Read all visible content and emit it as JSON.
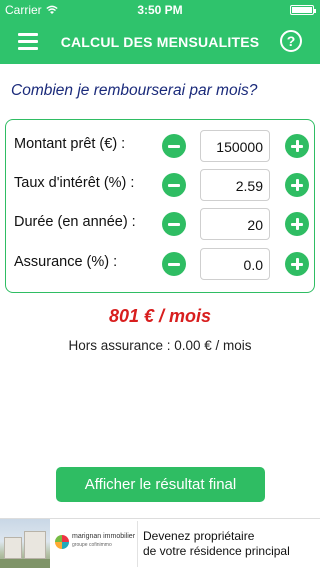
{
  "status_bar": {
    "carrier": "Carrier",
    "time": "3:50 PM",
    "wifi_icon": "wifi-icon",
    "battery_icon": "battery-icon"
  },
  "nav": {
    "title": "CALCUL DES MENSUALITES",
    "menu_icon": "hamburger-icon",
    "help_label": "?"
  },
  "question": "Combien je rembourserai par mois?",
  "fields": [
    {
      "label": "Montant prêt (€) :",
      "value": "150000"
    },
    {
      "label": "Taux d'intérêt (%) :",
      "value": "2.59"
    },
    {
      "label": "Durée (en année) :",
      "value": "20"
    },
    {
      "label": "Assurance (%) :",
      "value": "0.0"
    }
  ],
  "result": {
    "monthly": "801 € / mois",
    "hors_assurance": "Hors assurance : 0.00 € / mois"
  },
  "cta_label": "Afficher le résultat final",
  "banner": {
    "brand": "marignan immobilier",
    "brand_sub": "groupe cofinimmo",
    "line1": "Devenez propriétaire",
    "line2": "de votre résidence principal"
  },
  "colors": {
    "accent": "#2fbd63",
    "result": "#d81e1e",
    "question": "#1a2a7a"
  }
}
